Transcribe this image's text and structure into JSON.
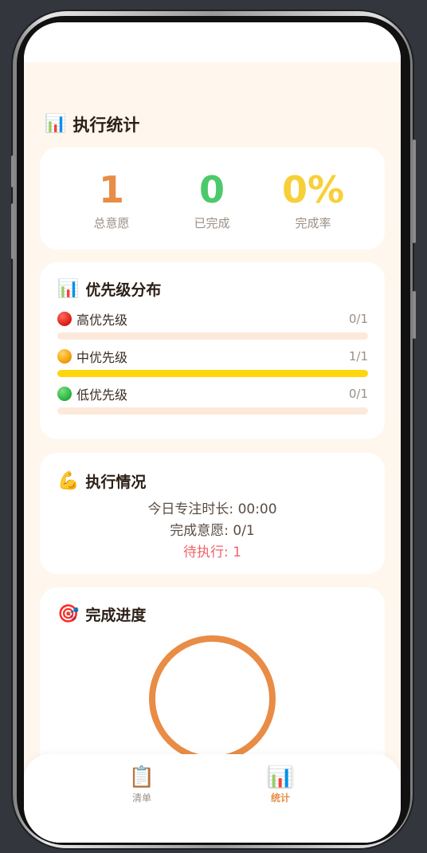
{
  "header": {
    "title": "执行统计",
    "icon": "📊"
  },
  "stats": [
    {
      "value": "1",
      "label": "总意愿",
      "color": "#e98c45"
    },
    {
      "value": "0",
      "label": "已完成",
      "color": "#4cc96b"
    },
    {
      "value": "0%",
      "label": "完成率",
      "color": "#f7d038"
    }
  ],
  "priority": {
    "title": "优先级分布",
    "icon": "📊",
    "items": [
      {
        "name": "高优先级",
        "count": "0/1",
        "fraction": 0,
        "dot_color": "#e0231c"
      },
      {
        "name": "中优先级",
        "count": "1/1",
        "fraction": 1,
        "dot_color": "#f5a30a"
      },
      {
        "name": "低优先级",
        "count": "0/1",
        "fraction": 0,
        "dot_color": "#2fb845"
      }
    ]
  },
  "execution": {
    "title": "执行情况",
    "icon": "💪",
    "focus_time": "今日专注时长: 00:00",
    "completed": "完成意愿: 0/1",
    "pending": "待执行: 1",
    "pending_color": "#f0646a"
  },
  "progress": {
    "title": "完成进度",
    "icon": "🎯",
    "ring_color": "#e98c45"
  },
  "tabs": [
    {
      "label": "清单",
      "icon": "📋",
      "active": false,
      "color": "#9b8f86"
    },
    {
      "label": "统计",
      "icon": "📊",
      "active": true,
      "color": "#e98c45"
    }
  ]
}
